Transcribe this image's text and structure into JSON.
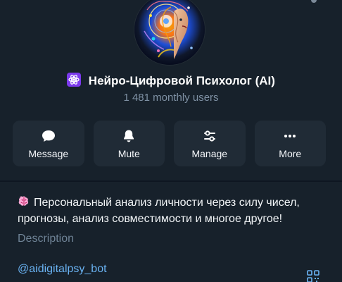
{
  "profile": {
    "name": "Нейро-Цифровой Психолог (AI)",
    "monthly_users": "1 481 monthly users",
    "avatar_icon": "avatar-icon",
    "name_icon": "atom-icon"
  },
  "actions": [
    {
      "label": "Message",
      "icon": "message-icon"
    },
    {
      "label": "Mute",
      "icon": "bell-icon"
    },
    {
      "label": "Manage",
      "icon": "sliders-icon"
    },
    {
      "label": "More",
      "icon": "more-icon"
    }
  ],
  "description": {
    "text": "Персональный анализ личности через силу чисел, прогнозы, анализ совместимости и многое другое!",
    "label": "Description",
    "emoji": "brain-icon"
  },
  "username": {
    "text": "@aidigitalpsy_bot",
    "qr_icon": "qr-code-icon"
  },
  "colors": {
    "background": "#0e1621",
    "panel": "#17212b",
    "button": "#202b36",
    "accent": "#6ab3f3",
    "muted": "#7f91a4",
    "purple": "#7c3aed"
  }
}
